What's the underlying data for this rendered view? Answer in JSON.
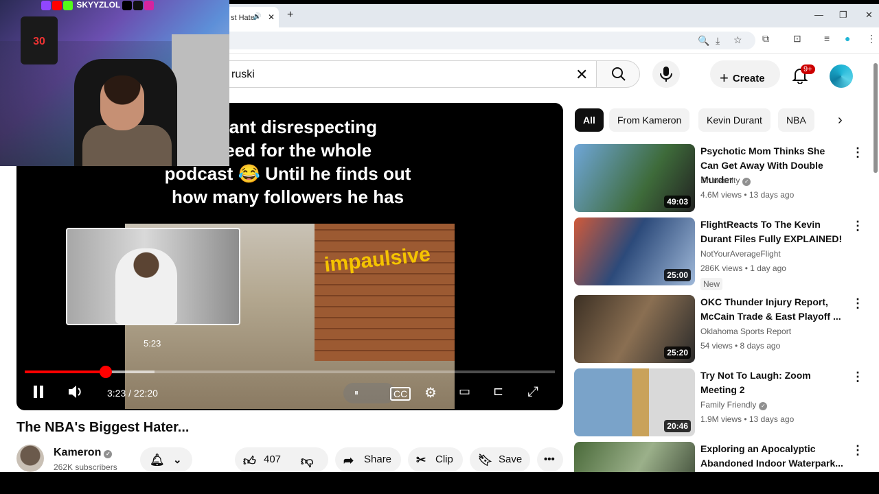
{
  "browser": {
    "tab_title": "st Hate",
    "close": "✕",
    "new_tab": "+"
  },
  "masthead": {
    "search_value": "ruski",
    "create_label": "Create",
    "notifications_badge": "9+"
  },
  "player": {
    "caption_lines": [
      "Durant disrespecting",
      "speed for the whole",
      "podcast 😂 Until he finds out",
      "how many followers he has"
    ],
    "scene_brand": "impaulsive",
    "hover_time": "5:23",
    "time_display": "3:23 / 22:20",
    "progress_fraction": 0.153,
    "buffered_fraction": 0.245
  },
  "video": {
    "title": "The NBA's Biggest Hater...",
    "channel_name": "Kameron",
    "subscribers": "262K subscribers",
    "like_count": "407",
    "share_label": "Share",
    "clip_label": "Clip",
    "save_label": "Save"
  },
  "chips": [
    "All",
    "From Kameron",
    "Kevin Durant",
    "NBA"
  ],
  "recommendations": [
    {
      "title": "Psychotic Mom Thinks She Can Get Away With Double Murder",
      "channel": "Dr Insanity",
      "verified": true,
      "meta": "4.6M views • 13 days ago",
      "duration": "49:03",
      "badge": "",
      "thumb_color": "#5b8fc4"
    },
    {
      "title": "FlightReacts To The Kevin Durant Files Fully EXPLAINED!",
      "channel": "NotYourAverageFlight",
      "verified": false,
      "meta": "286K views • 1 day ago",
      "duration": "25:00",
      "badge": "New",
      "thumb_color": "#2c4a7a"
    },
    {
      "title": "OKC Thunder Injury Report, McCain Trade & East Playoff ...",
      "channel": "Oklahoma Sports Report",
      "verified": false,
      "meta": "54 views • 8 days ago",
      "duration": "25:20",
      "badge": "",
      "thumb_color": "#3c3024"
    },
    {
      "title": "Try Not To Laugh: Zoom Meeting 2",
      "channel": "Family Friendly",
      "verified": true,
      "meta": "1.9M views • 13 days ago",
      "duration": "20:46",
      "badge": "",
      "thumb_color": "#7aa3c9"
    },
    {
      "title": "Exploring an Apocalyptic Abandoned Indoor Waterpark...",
      "channel": "",
      "verified": false,
      "meta": "",
      "duration": "",
      "badge": "",
      "thumb_color": "#5f7a4f"
    }
  ],
  "webcam": {
    "handle": "SKYYZLOL",
    "jersey_number": "30"
  }
}
